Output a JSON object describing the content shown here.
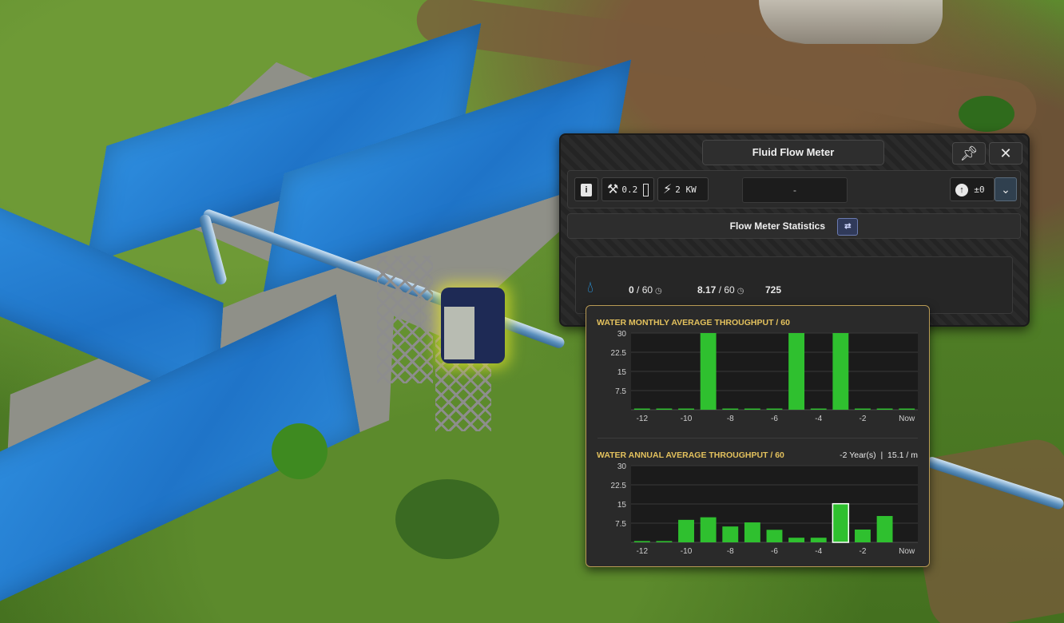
{
  "window": {
    "title": "Fluid Flow Meter",
    "pin_icon": "pin-icon",
    "close_icon": "close-icon"
  },
  "toolbar": {
    "info_icon": "info-icon",
    "maintenance_value": "0.2",
    "power_value": "2 KW",
    "name_value": "-",
    "priority_value": "±0",
    "dropdown_icon": "chevron-down-icon"
  },
  "stats": {
    "section_title": "Flow Meter Statistics",
    "toggle_icon": "swap-icon",
    "current": "0",
    "current_max": "/ 60",
    "average": "8.17",
    "average_max": "/ 60",
    "total": "725"
  },
  "colors": {
    "bar": "#2fc02f",
    "selected_bar_outline": "#ffffff",
    "title_gold": "#e3c15d",
    "water_blue": "#2aa0f0"
  },
  "chart_data": [
    {
      "type": "bar",
      "title": "WATER MONTHLY AVERAGE THROUGHPUT / 60",
      "categories": [
        "-12",
        "-11",
        "-10",
        "-9",
        "-8",
        "-7",
        "-6",
        "-5",
        "-4",
        "-3",
        "-2",
        "-1",
        "Now"
      ],
      "tick_labels": [
        "-12",
        "",
        "-10",
        "",
        "-8",
        "",
        "-6",
        "",
        "-4",
        "",
        "-2",
        "",
        "Now"
      ],
      "values": [
        0.3,
        0.3,
        0.3,
        30,
        0.3,
        0.3,
        0.3,
        30,
        0.3,
        30,
        0.3,
        0.3,
        0.3
      ],
      "y_ticks": [
        "30",
        "22.5",
        "15",
        "7.5"
      ],
      "ylim": [
        0,
        30
      ],
      "grid": true,
      "selected_index": -1
    },
    {
      "type": "bar",
      "title": "WATER ANNUAL AVERAGE THROUGHPUT / 60",
      "hover_info": "-2 Year(s)  |  15.1 / m",
      "categories": [
        "-12",
        "-11",
        "-10",
        "-9",
        "-8",
        "-7",
        "-6",
        "-5",
        "-4",
        "-3",
        "-2",
        "-1",
        "Now"
      ],
      "tick_labels": [
        "-12",
        "",
        "-10",
        "",
        "-8",
        "",
        "-6",
        "",
        "-4",
        "",
        "-2",
        "",
        "Now"
      ],
      "values": [
        0.5,
        0.5,
        8.8,
        9.8,
        6.2,
        7.8,
        4.9,
        1.8,
        1.8,
        15.1,
        5.0,
        10.3,
        0
      ],
      "y_ticks": [
        "30",
        "22.5",
        "15",
        "7.5"
      ],
      "ylim": [
        0,
        30
      ],
      "grid": true,
      "selected_index": 9
    }
  ]
}
